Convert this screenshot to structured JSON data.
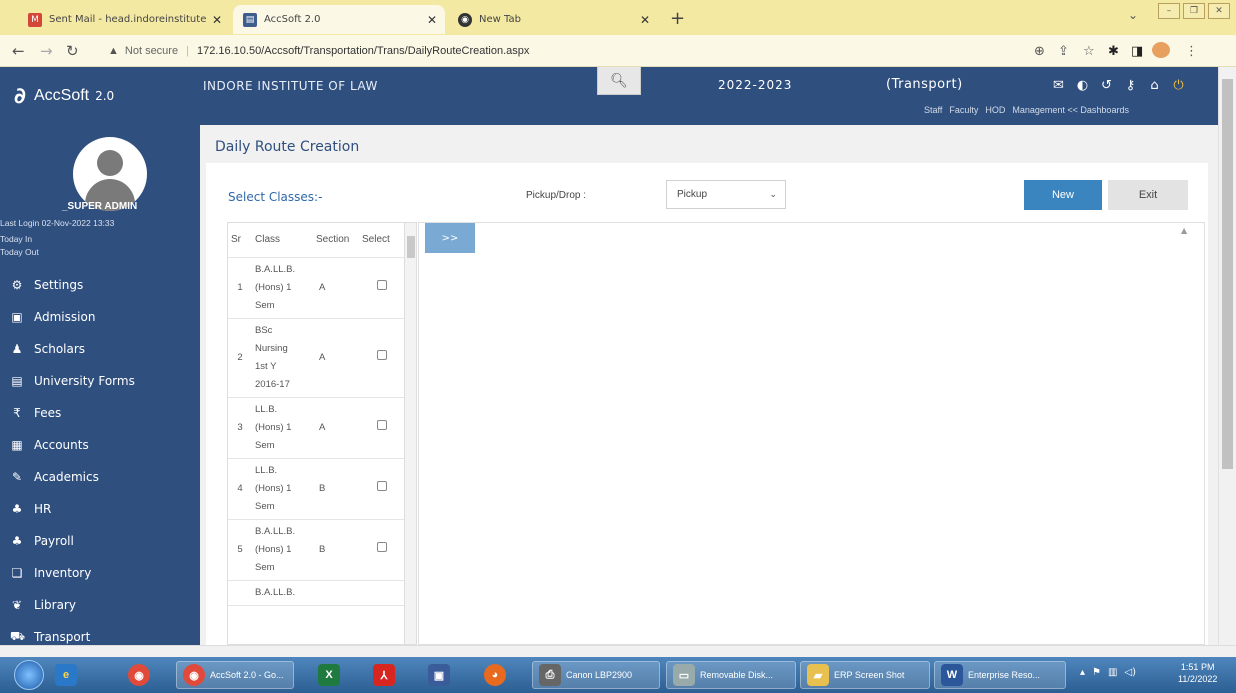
{
  "browser": {
    "tabs": [
      {
        "title": "Sent Mail - head.indoreinstitute",
        "icon": "gmail-icon"
      },
      {
        "title": "AccSoft 2.0",
        "icon": "app-icon"
      },
      {
        "title": "New Tab",
        "icon": "chrome-icon"
      }
    ],
    "new_tab": "+",
    "security_label": "Not secure",
    "url": "172.16.10.50/Accsoft/Transportation/Trans/DailyRouteCreation.aspx"
  },
  "header": {
    "app_name": "AccSoft",
    "app_version": "2.0",
    "institute": "INDORE INSTITUTE OF LAW",
    "session": "2022-2023",
    "module": "(Transport)",
    "links": [
      "Staff",
      "Faculty",
      "HOD",
      "Management << Dashboards"
    ]
  },
  "sidebar": {
    "user_name": "_SUPER ADMIN",
    "last_login": "Last Login  02-Nov-2022 13:33",
    "today_in": "Today In",
    "today_out": "Today Out",
    "items": [
      {
        "label": "Settings",
        "icon": "gear-icon"
      },
      {
        "label": "Admission",
        "icon": "admission-icon"
      },
      {
        "label": "Scholars",
        "icon": "user-icon"
      },
      {
        "label": "University Forms",
        "icon": "form-icon"
      },
      {
        "label": "Fees",
        "icon": "rupee-icon"
      },
      {
        "label": "Accounts",
        "icon": "ledger-icon"
      },
      {
        "label": "Academics",
        "icon": "pen-icon"
      },
      {
        "label": "HR",
        "icon": "users-icon"
      },
      {
        "label": "Payroll",
        "icon": "users-icon"
      },
      {
        "label": "Inventory",
        "icon": "box-icon"
      },
      {
        "label": "Library",
        "icon": "book-icon"
      },
      {
        "label": "Transport",
        "icon": "bus-icon"
      }
    ]
  },
  "page": {
    "title": "Daily Route Creation",
    "select_classes_label": "Select Classes:-",
    "pickup_drop_label": "Pickup/Drop :",
    "pickup_drop_value": "Pickup",
    "new_button": "New",
    "exit_button": "Exit",
    "move_button": ">>",
    "table": {
      "headers": [
        "Sr",
        "Class",
        "Section",
        "Select"
      ],
      "rows": [
        {
          "sr": "1",
          "class_lines": [
            "B.A.LL.B.",
            "(Hons) 1",
            "Sem"
          ],
          "section": "A"
        },
        {
          "sr": "2",
          "class_lines": [
            "BSc",
            "Nursing",
            "1st Y",
            "2016-17"
          ],
          "section": "A"
        },
        {
          "sr": "3",
          "class_lines": [
            "LL.B.",
            "(Hons) 1",
            "Sem"
          ],
          "section": "A"
        },
        {
          "sr": "4",
          "class_lines": [
            "LL.B.",
            "(Hons) 1",
            "Sem"
          ],
          "section": "B"
        },
        {
          "sr": "5",
          "class_lines": [
            "B.A.LL.B.",
            "(Hons) 1",
            "Sem"
          ],
          "section": "B"
        },
        {
          "sr": "",
          "class_lines": [
            "B.A.LL.B."
          ],
          "section": ""
        }
      ]
    }
  },
  "taskbar": {
    "apps": [
      {
        "label": "AccSoft 2.0 - Go...",
        "icon": "chrome-icon"
      },
      {
        "label": "",
        "icon": "excel-icon"
      },
      {
        "label": "",
        "icon": "pdf-icon"
      },
      {
        "label": "",
        "icon": "window-icon"
      },
      {
        "label": "",
        "icon": "firefox-icon"
      },
      {
        "label": "Canon LBP2900",
        "icon": "printer-icon"
      },
      {
        "label": "Removable Disk...",
        "icon": "drive-icon"
      },
      {
        "label": "ERP Screen Shot",
        "icon": "folder-icon"
      },
      {
        "label": "Enterprise Reso...",
        "icon": "word-icon"
      }
    ],
    "time": "1:51 PM",
    "date": "11/2/2022"
  },
  "colors": {
    "sidebar": "#2f4f7f",
    "accent": "#3a84c0",
    "tabbar": "#f3e9a3"
  }
}
